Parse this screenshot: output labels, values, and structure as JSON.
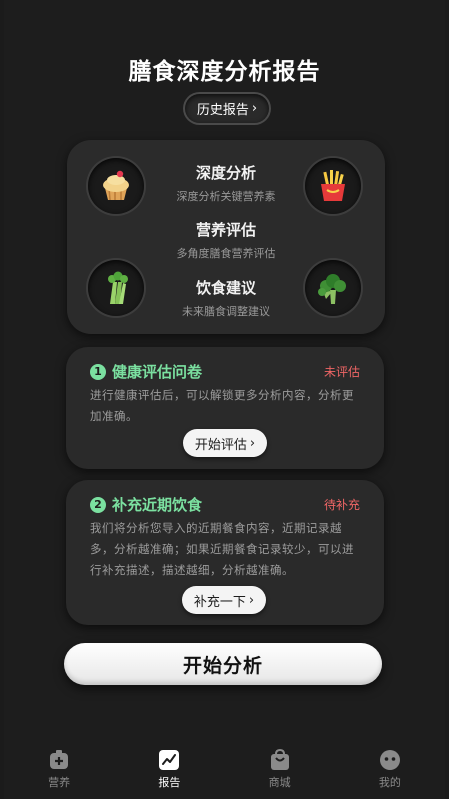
{
  "header": {
    "title": "膳食深度分析报告",
    "history_label": "历史报告",
    "chevron": "›"
  },
  "features": [
    {
      "title": "深度分析",
      "desc": "深度分析关键营养素"
    },
    {
      "title": "营养评估",
      "desc": "多角度膳食营养评估"
    },
    {
      "title": "饮食建议",
      "desc": "未来膳食调整建议"
    }
  ],
  "feature_icons": [
    "cupcake-icon",
    "french-fries-icon",
    "celery-icon",
    "broccoli-icon"
  ],
  "tasks": [
    {
      "num": "1",
      "title": "健康评估问卷",
      "status": "未评估",
      "desc": "进行健康评估后，可以解锁更多分析内容，分析更加准确。",
      "button": "开始评估"
    },
    {
      "num": "2",
      "title": "补充近期饮食",
      "status": "待补充",
      "desc": "我们将分析您导入的近期餐食内容，近期记录越多，分析越准确；如果近期餐食记录较少，可以进行补充描述，描述越细，分析越准确。",
      "button": "补充一下"
    }
  ],
  "start_button": "开始分析",
  "tabbar": [
    {
      "label": "营养",
      "icon": "plus-box-icon"
    },
    {
      "label": "报告",
      "icon": "chart-icon",
      "active": true
    },
    {
      "label": "商城",
      "icon": "shopping-bag-icon"
    },
    {
      "label": "我的",
      "icon": "face-icon"
    }
  ],
  "colors": {
    "accent_green": "#7be0a0",
    "status_red": "#f06666",
    "background": "#1d1d1d",
    "card": "#2b2b2b"
  }
}
